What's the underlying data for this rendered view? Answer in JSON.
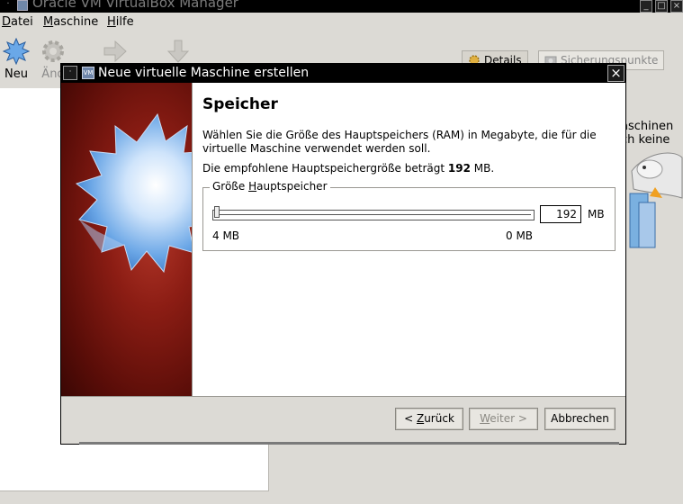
{
  "main_window": {
    "title": "Oracle VM VirtualBox Manager",
    "menu": [
      "Datei",
      "Maschine",
      "Hilfe"
    ],
    "toolbar": {
      "new_label": "Neu",
      "change_label": "Änd"
    },
    "tabs": {
      "details": "Details",
      "snapshots": "Sicherungspunkte"
    },
    "right_text": [
      "aschinen",
      "ch keine"
    ]
  },
  "dialog": {
    "title": "Neue virtuelle Maschine erstellen",
    "page_title": "Speicher",
    "description": "Wählen Sie die Größe des Hauptspeichers (RAM) in Megabyte, die für die virtuelle Maschine verwendet werden soll.",
    "recommend_prefix": "Die empfohlene Hauptspeichergröße beträgt ",
    "recommend_value": "192",
    "recommend_suffix": " MB.",
    "group": {
      "legend_pre": "Größe ",
      "legend_underlined": "H",
      "legend_post": "auptspeicher"
    },
    "memory": {
      "value": "192",
      "unit": "MB",
      "min_label": "4 MB",
      "max_label": "0 MB",
      "slider_fraction": 0.0
    },
    "buttons": {
      "back_pre": "< ",
      "back_underlined": "Z",
      "back_post": "urück",
      "next_pre": "",
      "next_underlined": "W",
      "next_post": "eiter >",
      "cancel": "Abbrechen"
    }
  }
}
